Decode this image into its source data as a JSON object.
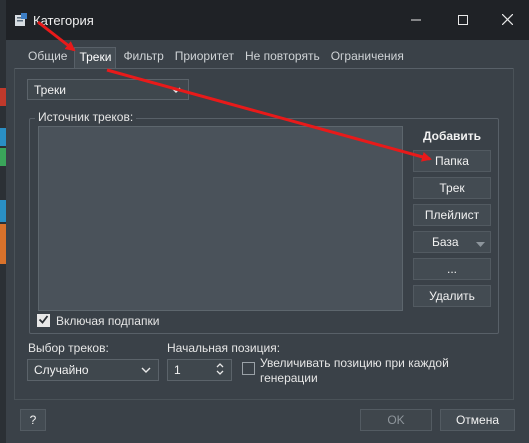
{
  "window": {
    "title": "Категория",
    "icons": {
      "app": "app-icon",
      "minimize": "minimize-icon",
      "maximize": "maximize-icon",
      "close": "close-icon"
    }
  },
  "tabs": [
    {
      "label": "Общие",
      "active": false
    },
    {
      "label": "Треки",
      "active": true
    },
    {
      "label": "Фильтр",
      "active": false
    },
    {
      "label": "Приоритет",
      "active": false
    },
    {
      "label": "Не повторять",
      "active": false
    },
    {
      "label": "Ограничения",
      "active": false
    }
  ],
  "source_type": {
    "value": "Треки"
  },
  "group": {
    "label": "Источник треков:",
    "add_label": "Добавить",
    "buttons": {
      "folder": "Папка",
      "track": "Трек",
      "playlist": "Плейлист",
      "database": "База",
      "more": "...",
      "delete": "Удалить"
    },
    "include_subfolders": {
      "label": "Включая подпапки",
      "checked": true
    }
  },
  "track_selection": {
    "label": "Выбор треков:",
    "value": "Случайно"
  },
  "start_position": {
    "label": "Начальная позиция:",
    "value": "1"
  },
  "increment": {
    "label": "Увеличивать позицию при каждой генерации",
    "checked": false
  },
  "footer": {
    "help": "?",
    "ok": "OK",
    "cancel": "Отмена"
  },
  "colors": {
    "accent_arrow": "#e81a1a",
    "background": "#3a4148",
    "titlebar": "#1f2226"
  }
}
